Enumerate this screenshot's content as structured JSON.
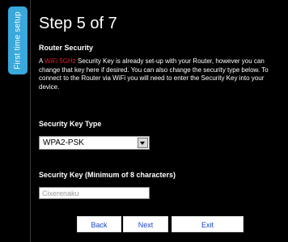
{
  "side_tab": {
    "label": "First time setup"
  },
  "header": {
    "title": "Step 5 of 7"
  },
  "section": {
    "title": "Router Security",
    "description_prefix": "A ",
    "description_highlight": "WiFi 5GHz",
    "description_suffix": " Security Key is already set-up with your Router, however you can change that key here if desired. You can also change the security type below. To connect to the Router via WiFi you will need to enter the Security Key into your device.",
    "highlight_color": "#e0202a"
  },
  "security_type": {
    "label": "Security Key Type",
    "selected": "WPA2-PSK"
  },
  "security_key": {
    "label": "Security Key (Minimum of 8 characters)",
    "value": "Cixerenaku"
  },
  "buttons": {
    "back": "Back",
    "next": "Next",
    "exit": "Exit"
  }
}
